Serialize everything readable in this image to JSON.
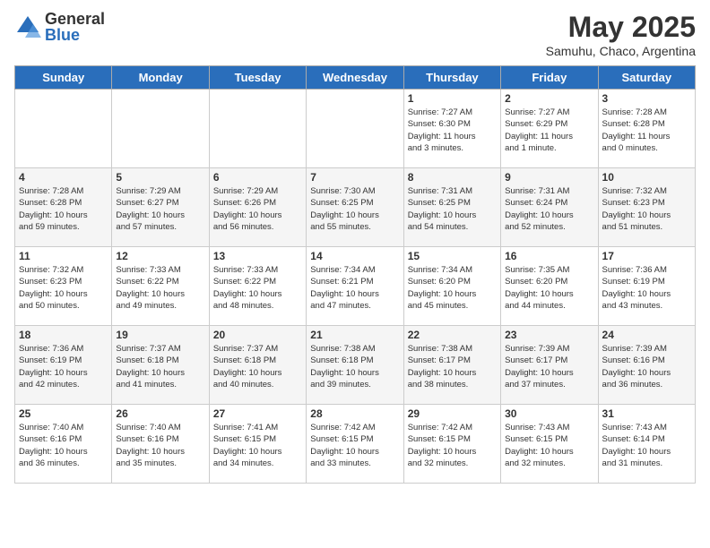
{
  "header": {
    "logo_general": "General",
    "logo_blue": "Blue",
    "month_title": "May 2025",
    "subtitle": "Samuhu, Chaco, Argentina"
  },
  "days_of_week": [
    "Sunday",
    "Monday",
    "Tuesday",
    "Wednesday",
    "Thursday",
    "Friday",
    "Saturday"
  ],
  "weeks": [
    [
      {
        "day": "",
        "info": ""
      },
      {
        "day": "",
        "info": ""
      },
      {
        "day": "",
        "info": ""
      },
      {
        "day": "",
        "info": ""
      },
      {
        "day": "1",
        "info": "Sunrise: 7:27 AM\nSunset: 6:30 PM\nDaylight: 11 hours\nand 3 minutes."
      },
      {
        "day": "2",
        "info": "Sunrise: 7:27 AM\nSunset: 6:29 PM\nDaylight: 11 hours\nand 1 minute."
      },
      {
        "day": "3",
        "info": "Sunrise: 7:28 AM\nSunset: 6:28 PM\nDaylight: 11 hours\nand 0 minutes."
      }
    ],
    [
      {
        "day": "4",
        "info": "Sunrise: 7:28 AM\nSunset: 6:28 PM\nDaylight: 10 hours\nand 59 minutes."
      },
      {
        "day": "5",
        "info": "Sunrise: 7:29 AM\nSunset: 6:27 PM\nDaylight: 10 hours\nand 57 minutes."
      },
      {
        "day": "6",
        "info": "Sunrise: 7:29 AM\nSunset: 6:26 PM\nDaylight: 10 hours\nand 56 minutes."
      },
      {
        "day": "7",
        "info": "Sunrise: 7:30 AM\nSunset: 6:25 PM\nDaylight: 10 hours\nand 55 minutes."
      },
      {
        "day": "8",
        "info": "Sunrise: 7:31 AM\nSunset: 6:25 PM\nDaylight: 10 hours\nand 54 minutes."
      },
      {
        "day": "9",
        "info": "Sunrise: 7:31 AM\nSunset: 6:24 PM\nDaylight: 10 hours\nand 52 minutes."
      },
      {
        "day": "10",
        "info": "Sunrise: 7:32 AM\nSunset: 6:23 PM\nDaylight: 10 hours\nand 51 minutes."
      }
    ],
    [
      {
        "day": "11",
        "info": "Sunrise: 7:32 AM\nSunset: 6:23 PM\nDaylight: 10 hours\nand 50 minutes."
      },
      {
        "day": "12",
        "info": "Sunrise: 7:33 AM\nSunset: 6:22 PM\nDaylight: 10 hours\nand 49 minutes."
      },
      {
        "day": "13",
        "info": "Sunrise: 7:33 AM\nSunset: 6:22 PM\nDaylight: 10 hours\nand 48 minutes."
      },
      {
        "day": "14",
        "info": "Sunrise: 7:34 AM\nSunset: 6:21 PM\nDaylight: 10 hours\nand 47 minutes."
      },
      {
        "day": "15",
        "info": "Sunrise: 7:34 AM\nSunset: 6:20 PM\nDaylight: 10 hours\nand 45 minutes."
      },
      {
        "day": "16",
        "info": "Sunrise: 7:35 AM\nSunset: 6:20 PM\nDaylight: 10 hours\nand 44 minutes."
      },
      {
        "day": "17",
        "info": "Sunrise: 7:36 AM\nSunset: 6:19 PM\nDaylight: 10 hours\nand 43 minutes."
      }
    ],
    [
      {
        "day": "18",
        "info": "Sunrise: 7:36 AM\nSunset: 6:19 PM\nDaylight: 10 hours\nand 42 minutes."
      },
      {
        "day": "19",
        "info": "Sunrise: 7:37 AM\nSunset: 6:18 PM\nDaylight: 10 hours\nand 41 minutes."
      },
      {
        "day": "20",
        "info": "Sunrise: 7:37 AM\nSunset: 6:18 PM\nDaylight: 10 hours\nand 40 minutes."
      },
      {
        "day": "21",
        "info": "Sunrise: 7:38 AM\nSunset: 6:18 PM\nDaylight: 10 hours\nand 39 minutes."
      },
      {
        "day": "22",
        "info": "Sunrise: 7:38 AM\nSunset: 6:17 PM\nDaylight: 10 hours\nand 38 minutes."
      },
      {
        "day": "23",
        "info": "Sunrise: 7:39 AM\nSunset: 6:17 PM\nDaylight: 10 hours\nand 37 minutes."
      },
      {
        "day": "24",
        "info": "Sunrise: 7:39 AM\nSunset: 6:16 PM\nDaylight: 10 hours\nand 36 minutes."
      }
    ],
    [
      {
        "day": "25",
        "info": "Sunrise: 7:40 AM\nSunset: 6:16 PM\nDaylight: 10 hours\nand 36 minutes."
      },
      {
        "day": "26",
        "info": "Sunrise: 7:40 AM\nSunset: 6:16 PM\nDaylight: 10 hours\nand 35 minutes."
      },
      {
        "day": "27",
        "info": "Sunrise: 7:41 AM\nSunset: 6:15 PM\nDaylight: 10 hours\nand 34 minutes."
      },
      {
        "day": "28",
        "info": "Sunrise: 7:42 AM\nSunset: 6:15 PM\nDaylight: 10 hours\nand 33 minutes."
      },
      {
        "day": "29",
        "info": "Sunrise: 7:42 AM\nSunset: 6:15 PM\nDaylight: 10 hours\nand 32 minutes."
      },
      {
        "day": "30",
        "info": "Sunrise: 7:43 AM\nSunset: 6:15 PM\nDaylight: 10 hours\nand 32 minutes."
      },
      {
        "day": "31",
        "info": "Sunrise: 7:43 AM\nSunset: 6:14 PM\nDaylight: 10 hours\nand 31 minutes."
      }
    ]
  ]
}
